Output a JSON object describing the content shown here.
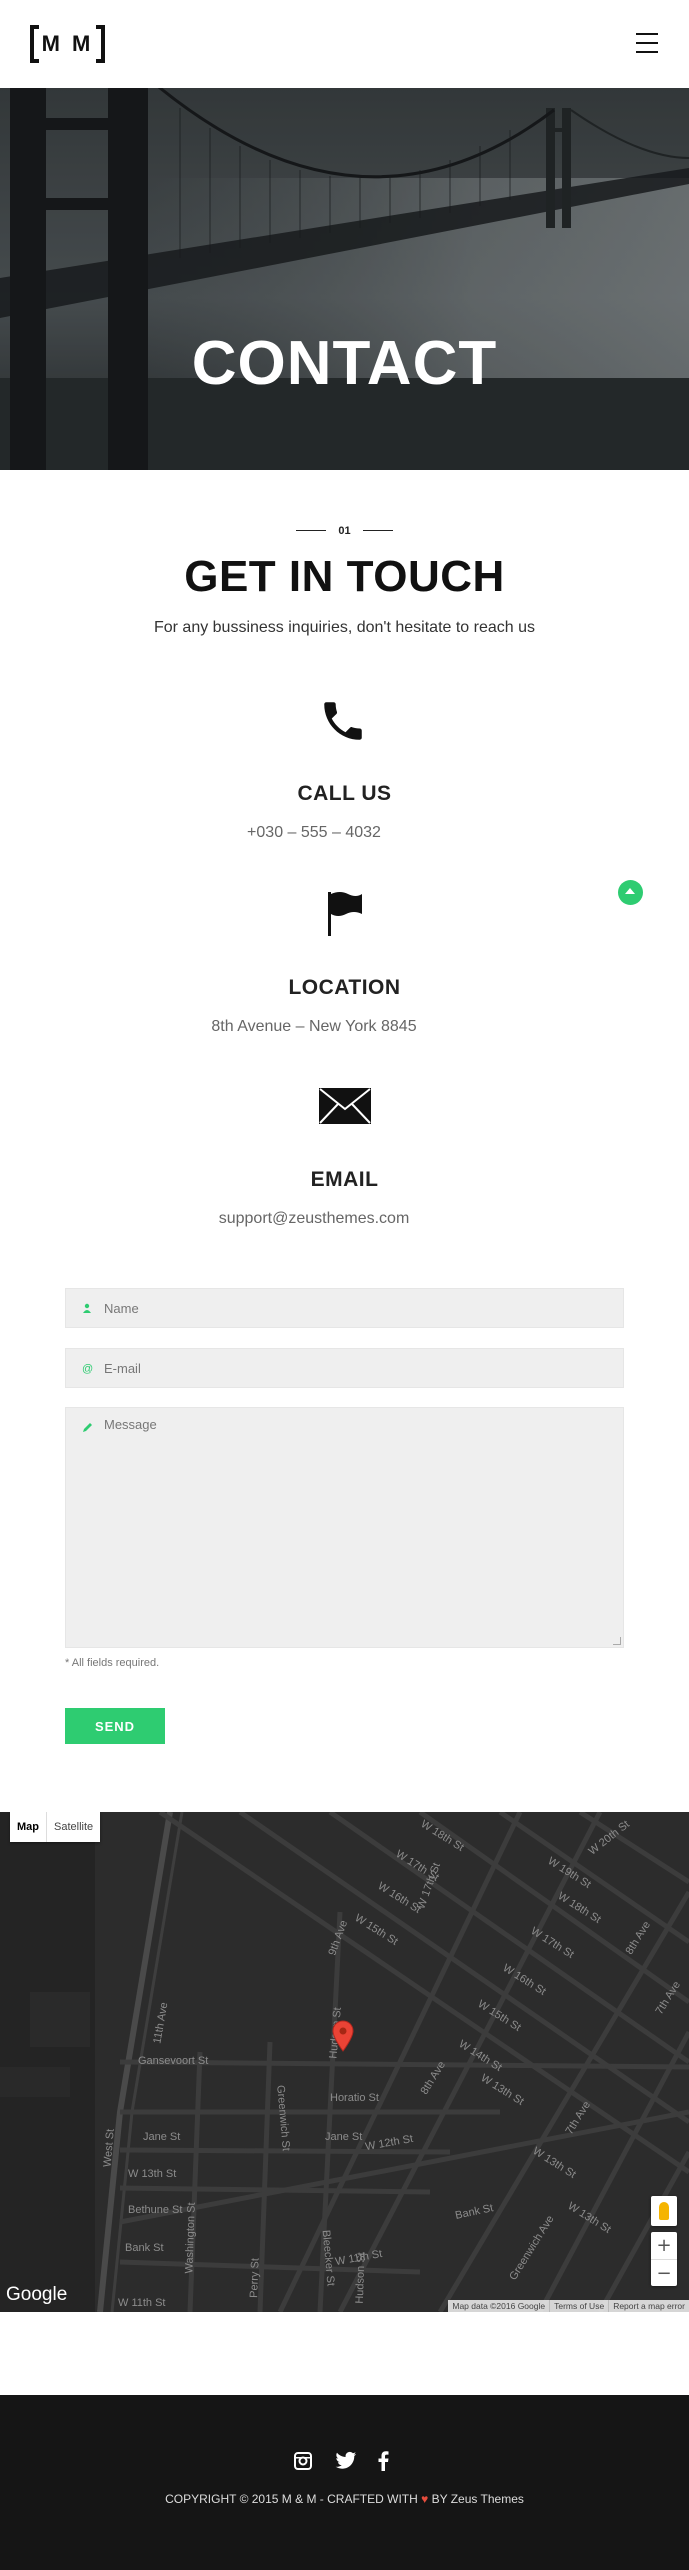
{
  "header": {
    "logo_text": "M M",
    "menu_icon": "hamburger-icon"
  },
  "hero": {
    "title": "CONTACT"
  },
  "section": {
    "number": "01",
    "title": "GET IN TOUCH",
    "subtitle": "For any bussiness inquiries, don't hesitate to reach us"
  },
  "contacts": [
    {
      "icon": "phone-icon",
      "title": "CALL US",
      "value": "+030 – 555 – 4032"
    },
    {
      "icon": "flag-icon",
      "title": "LOCATION",
      "value": "8th Avenue – New York 8845"
    },
    {
      "icon": "envelope-icon",
      "title": "EMAIL",
      "value": "support@zeusthemes.com"
    }
  ],
  "form": {
    "name_placeholder": "Name",
    "email_placeholder": "E-mail",
    "message_placeholder": "Message",
    "required_note": "* All fields required.",
    "send_label": "SEND"
  },
  "map": {
    "type_map": "Map",
    "type_satellite": "Satellite",
    "google_label": "Google",
    "map_data": "Map data ©2016 Google",
    "terms": "Terms of Use",
    "report": "Report a map error",
    "zoom_in": "+",
    "zoom_out": "−",
    "streets": [
      "W 18th St",
      "W 20th St",
      "W 17th St",
      "W 19th St",
      "W 16th St",
      "W 18th St",
      "W 15th St",
      "W 17th St",
      "W 16th St",
      "W 15th St",
      "W 14th St",
      "W 13th St",
      "W 12th St",
      "Gansevoort St",
      "Horatio St",
      "Jane St",
      "Jane St",
      "W 12th St",
      "Bethune St",
      "Bank St",
      "W 11th St",
      "W 11th St",
      "Bank St",
      "W 13th St",
      "W 14th St",
      "W 12th St",
      "11th Ave",
      "West St",
      "9th Ave",
      "8th Ave",
      "7th Ave",
      "Greenwich St",
      "Washington St",
      "Hudson St",
      "Bleecker St",
      "Perry St",
      "Greenwich Ave",
      "W 17th St",
      "7th Ave",
      "8th Ave",
      "Hudson St",
      "W 13th St"
    ]
  },
  "footer": {
    "copyright_prefix": "COPYRIGHT © 2015 M & M - CRAFTED WITH",
    "heart": "♥",
    "copyright_suffix": "BY Zeus Themes",
    "social": [
      "instagram-icon",
      "twitter-icon",
      "facebook-icon"
    ]
  },
  "colors": {
    "accent": "#2ecc71",
    "footer_bg": "#151515",
    "map_bg": "#2c2c2c",
    "pin": "#ea4335"
  }
}
